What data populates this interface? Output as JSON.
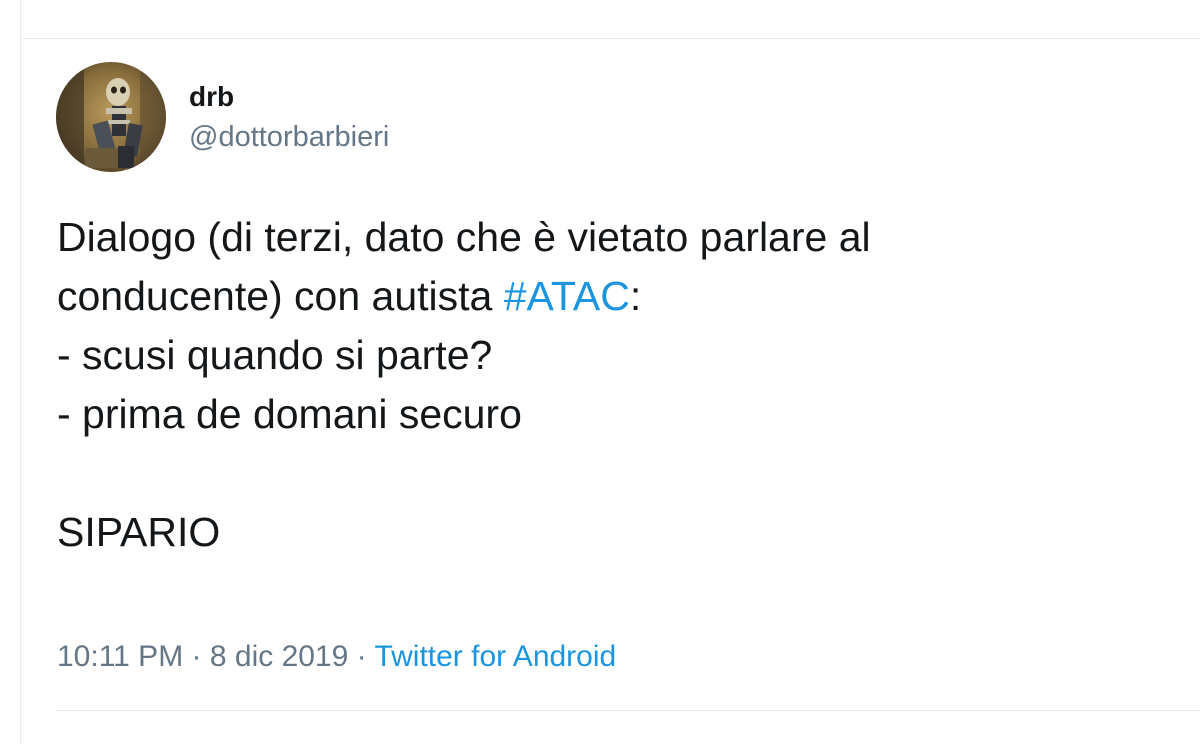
{
  "author": {
    "display_name": "drb",
    "handle": "@dottorbarbieri",
    "avatar_icon": "profile-avatar"
  },
  "tweet": {
    "line1": "Dialogo (di terzi, dato che è vietato parlare al",
    "line2_prefix": "conducente) con autista ",
    "hashtag": "#ATAC",
    "line2_suffix": ":",
    "line3": "- scusi quando si parte?",
    "line4": "- prima de domani securo",
    "line5": "SIPARIO"
  },
  "meta": {
    "time": "10:11 PM",
    "separator1": " · ",
    "date": "8 dic 2019",
    "separator2": " · ",
    "source": "Twitter for Android"
  },
  "colors": {
    "link": "#1b95e0",
    "text": "#14171a",
    "secondary": "#657786",
    "divider": "#e6ecf0"
  }
}
